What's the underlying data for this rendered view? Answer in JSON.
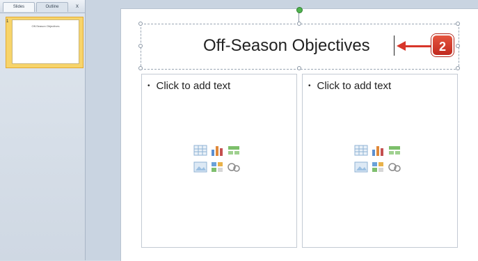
{
  "pane": {
    "tabs": [
      {
        "label": "Slides"
      },
      {
        "label": "Outline"
      }
    ],
    "close_glyph": "x",
    "thumbnail": {
      "number": "1",
      "title": "Off-Season Objectives"
    }
  },
  "slide": {
    "title": "Off-Season Objectives",
    "left_placeholder": {
      "bullet": "•",
      "text": "Click to add text"
    },
    "right_placeholder": {
      "bullet": "•",
      "text": "Click to add text"
    },
    "insert_icons": [
      "table-icon",
      "chart-icon",
      "smartart-icon",
      "picture-icon",
      "clip-art-icon",
      "media-clip-icon"
    ]
  },
  "callout": {
    "number": "2",
    "color": "#d8362a"
  },
  "colors": {
    "selected_thumbnail": "#f7d46a",
    "rotation_handle": "#4fb34f"
  }
}
